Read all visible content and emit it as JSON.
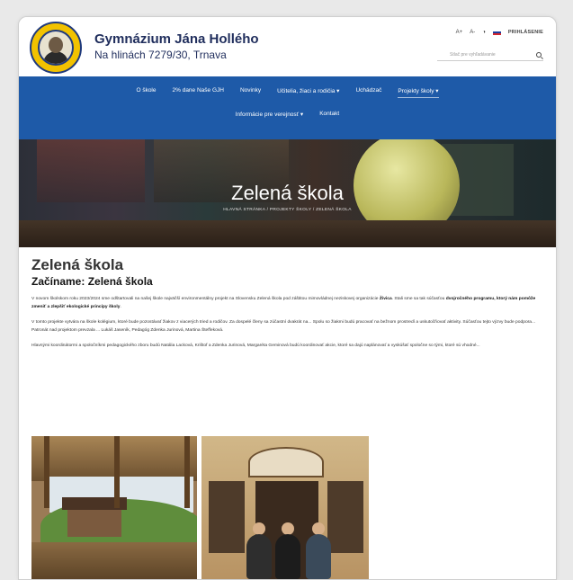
{
  "header": {
    "school_name": "Gymnázium Jána Hollého",
    "address": "Na hlinách 7279/30, Trnava",
    "font_larger": "A+",
    "font_smaller": "A-",
    "contrast": "◑",
    "login": "PRIHLÁSENIE",
    "search_placeholder": "Stlač pre vyhľadávanie"
  },
  "nav": {
    "row1": [
      "O škole",
      "2% dane Naše GJH",
      "Novinky",
      "Učitelia, žiaci a rodičia ▾",
      "Uchádzač",
      "Projekty školy ▾"
    ],
    "row2": [
      "Informácie pre verejnosť ▾",
      "Kontakt"
    ],
    "active": "Projekty školy ▾"
  },
  "hero": {
    "title": "Zelená škola",
    "breadcrumb": "HLAVNÁ STRÁNKA / PROJEKTY ŠKOLY / ZELENÁ ŠKOLA"
  },
  "content": {
    "title": "Zelená škola",
    "subtitle": "Začíname: Zelená škola",
    "p1_a": "V novom školskom roku 2023/2024 sme odštartovali na našej škole najväčší environmentálny projekt na Slovensku Zelená škola pod záštitou mimovládnej neziskovej organizácie ",
    "p1_b": "Živica",
    "p1_c": ". Stali sme sa tak súčasťou ",
    "p1_d": "dvojročného programu, ktorý nám pomôže zmeniť a zlepšiť ekologické princípy školy",
    "p1_e": ".",
    "p2": "V tomto projekte vytvára na škole kolégium, ktoré bude pozostávať žiakov z viacerých tried a rodičov. Za dospelé členy sa zúčastní dvakrát na... Spolu so žiakmi budú pracovať na bežnom prostredí a uskutočňovať aktivity. Súčasťou tejto výzvy bude podpora... Patronát nad projektom prevzala ... Lukáš Jaseník, Pedagóg Zdenka Jurinová, Martina Šteffeková.",
    "p3": "Hlavnými koordinátormi a spoločníkmi pedagogického zboru budú Natália Lacková, Krištof a Zdenka Jurinová, Margaréta Geminová budú koordinovať akcie, ktoré sa dajú naplánovať a vyskúšať spoločne so tými, ktoré sú vhodné..."
  },
  "photos": [
    "photo-school-pavilion",
    "photo-eco-shop-visit"
  ]
}
